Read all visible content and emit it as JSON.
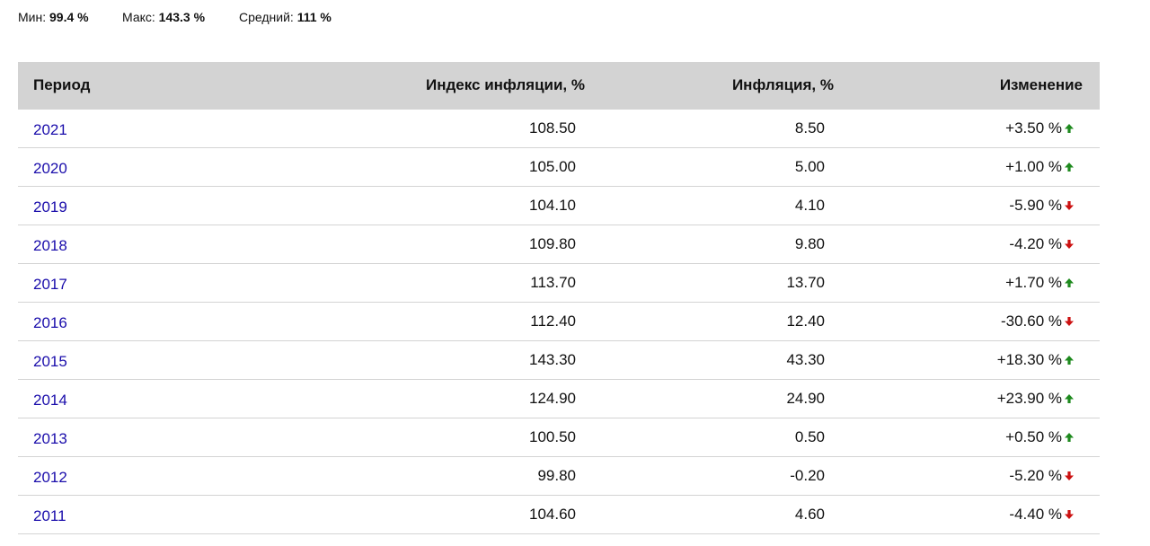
{
  "summary": {
    "min_label": "Мин:",
    "min_value": "99.4 %",
    "max_label": "Макс:",
    "max_value": "143.3 %",
    "avg_label": "Средний:",
    "avg_value": "111 %"
  },
  "table": {
    "headers": {
      "period": "Период",
      "index": "Индекс инфляции, %",
      "inflation": "Инфляция, %",
      "change": "Изменение"
    },
    "rows": [
      {
        "period": "2021",
        "index": "108.50",
        "inflation": "8.50",
        "change": "+3.50 %",
        "direction": "up"
      },
      {
        "period": "2020",
        "index": "105.00",
        "inflation": "5.00",
        "change": "+1.00 %",
        "direction": "up"
      },
      {
        "period": "2019",
        "index": "104.10",
        "inflation": "4.10",
        "change": "-5.90 %",
        "direction": "down"
      },
      {
        "period": "2018",
        "index": "109.80",
        "inflation": "9.80",
        "change": "-4.20 %",
        "direction": "down"
      },
      {
        "period": "2017",
        "index": "113.70",
        "inflation": "13.70",
        "change": "+1.70 %",
        "direction": "up"
      },
      {
        "period": "2016",
        "index": "112.40",
        "inflation": "12.40",
        "change": "-30.60 %",
        "direction": "down"
      },
      {
        "period": "2015",
        "index": "143.30",
        "inflation": "43.30",
        "change": "+18.30 %",
        "direction": "up"
      },
      {
        "period": "2014",
        "index": "124.90",
        "inflation": "24.90",
        "change": "+23.90 %",
        "direction": "up"
      },
      {
        "period": "2013",
        "index": "100.50",
        "inflation": "0.50",
        "change": "+0.50 %",
        "direction": "up"
      },
      {
        "period": "2012",
        "index": "99.80",
        "inflation": "-0.20",
        "change": "-5.20 %",
        "direction": "down"
      },
      {
        "period": "2011",
        "index": "104.60",
        "inflation": "4.60",
        "change": "-4.40 %",
        "direction": "down"
      }
    ]
  },
  "colors": {
    "link": "#1a0dab",
    "up": "#1e8a1e",
    "down": "#cc1111",
    "header_bg": "#d3d3d3"
  }
}
